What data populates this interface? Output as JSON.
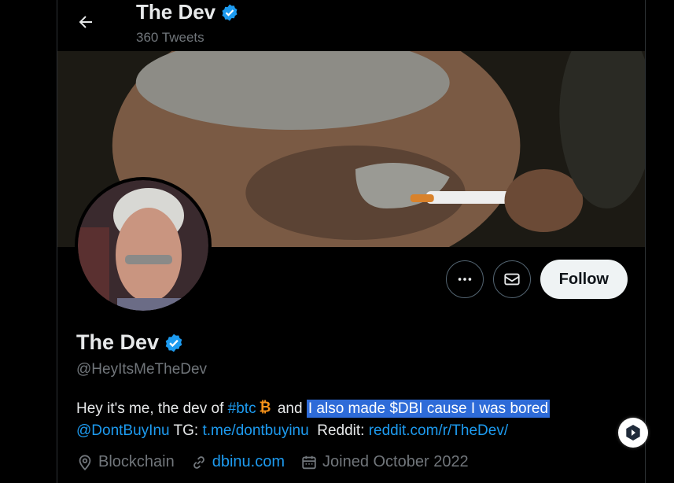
{
  "header": {
    "name": "The Dev",
    "tweets_count": "360 Tweets"
  },
  "actions": {
    "follow_label": "Follow"
  },
  "profile": {
    "name": "The Dev",
    "handle": "@HeyItsMeTheDev",
    "bio": {
      "part1": "Hey it's me, the dev of ",
      "hashtag": "#btc",
      "part2": " and ",
      "highlighted": "I also made $DBI cause I was bored",
      "mention": "@DontBuyInu",
      "tg_label": " TG: ",
      "tg_link": "t.me/dontbuyinu",
      "reddit_label": "  Reddit: ",
      "reddit_link": "reddit.com/r/TheDev/"
    },
    "location": "Blockchain",
    "website": "dbinu.com",
    "joined": "Joined October 2022"
  },
  "colors": {
    "accent": "#1d9bf0",
    "verified": "#1d9bf0",
    "highlight": "#2e6bd8",
    "bitcoin": "#f7931a"
  },
  "icons": [
    "back-arrow-icon",
    "verified-badge-icon",
    "more-icon",
    "message-icon",
    "location-icon",
    "link-icon",
    "calendar-icon",
    "bitcoin-icon",
    "floating-action-icon"
  ]
}
